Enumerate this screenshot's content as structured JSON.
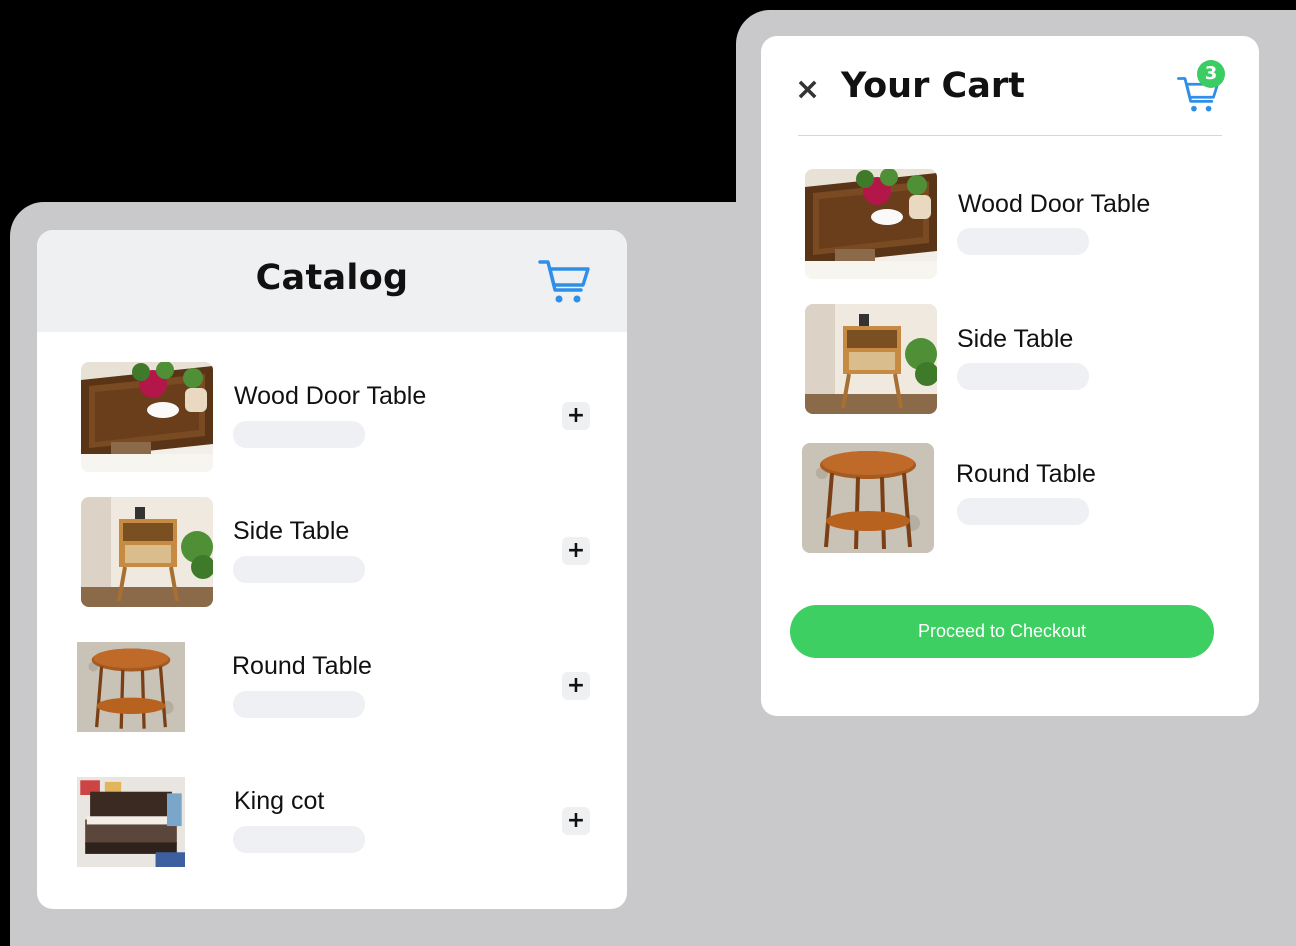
{
  "catalog": {
    "title": "Catalog",
    "items": [
      {
        "name": "Wood Door Table",
        "add_label": "+"
      },
      {
        "name": "Side Table",
        "add_label": "+"
      },
      {
        "name": "Round Table",
        "add_label": "+"
      },
      {
        "name": "King cot",
        "add_label": "+"
      }
    ]
  },
  "cart": {
    "title": "Your Cart",
    "close_label": "×",
    "count": "3",
    "items": [
      {
        "name": "Wood Door Table"
      },
      {
        "name": "Side Table"
      },
      {
        "name": "Round Table"
      }
    ],
    "checkout_label": "Proceed to Checkout"
  },
  "colors": {
    "accent_blue": "#2f8fe8",
    "checkout_green": "#3ecf63",
    "badge_green": "#3ccc64",
    "header_bg": "#eef0f2"
  },
  "icons": {
    "cart": "shopping-cart-icon",
    "close": "close-icon",
    "add": "plus-icon"
  }
}
